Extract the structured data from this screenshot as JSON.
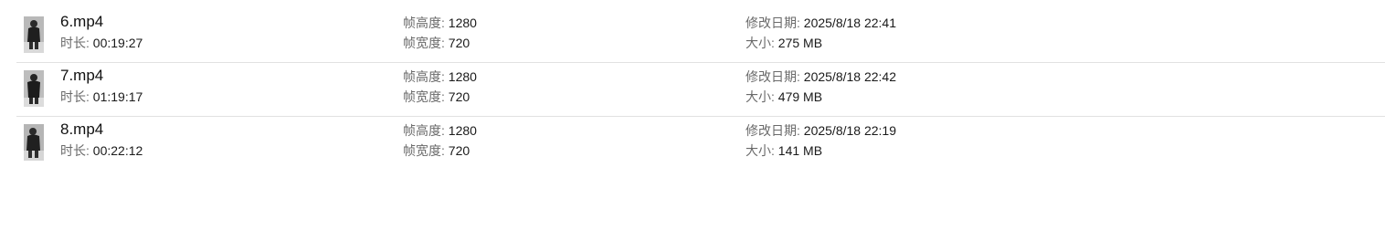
{
  "files": [
    {
      "name": "6.mp4",
      "duration_label": "时长:",
      "duration": "00:19:27",
      "height_label": "帧高度:",
      "height": "1280",
      "width_label": "帧宽度:",
      "width": "720",
      "modified_label": "修改日期:",
      "modified": "2025/8/18 22:41",
      "size_label": "大小:",
      "size": "275 MB"
    },
    {
      "name": "7.mp4",
      "duration_label": "时长:",
      "duration": "01:19:17",
      "height_label": "帧高度:",
      "height": "1280",
      "width_label": "帧宽度:",
      "width": "720",
      "modified_label": "修改日期:",
      "modified": "2025/8/18 22:42",
      "size_label": "大小:",
      "size": "479 MB"
    },
    {
      "name": "8.mp4",
      "duration_label": "时长:",
      "duration": "00:22:12",
      "height_label": "帧高度:",
      "height": "1280",
      "width_label": "帧宽度:",
      "width": "720",
      "modified_label": "修改日期:",
      "modified": "2025/8/18 22:19",
      "size_label": "大小:",
      "size": "141 MB"
    }
  ],
  "thumbnail_icon": "video-thumbnail-icon"
}
